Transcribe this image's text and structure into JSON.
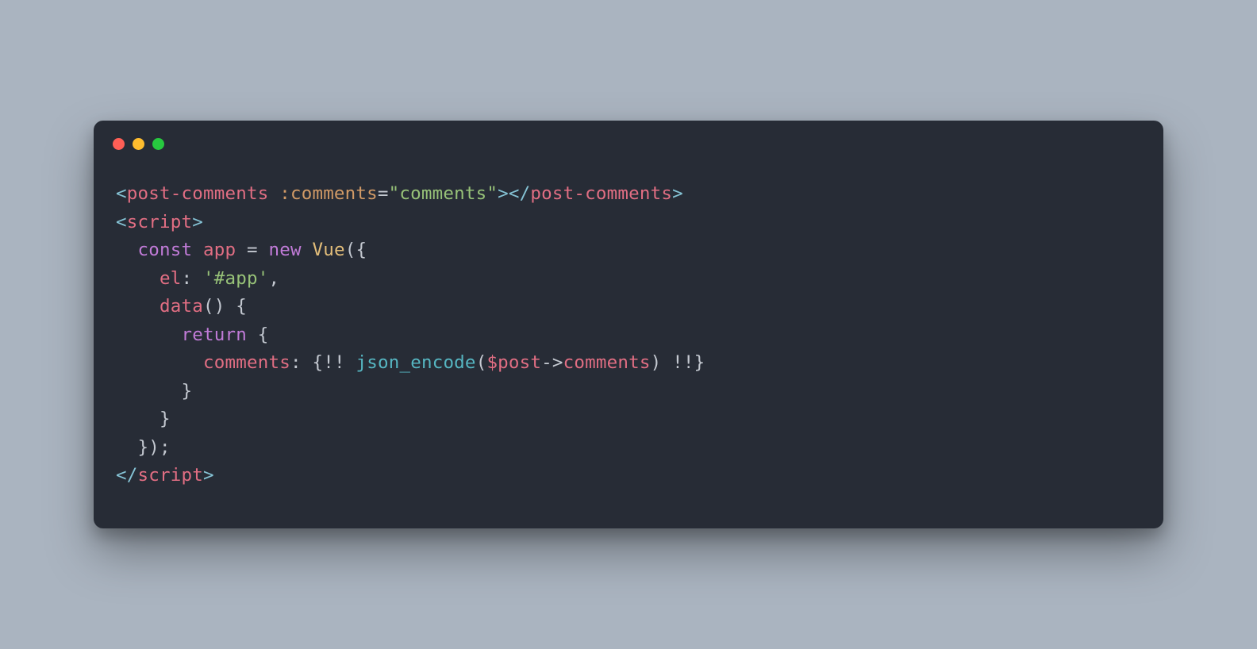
{
  "colors": {
    "background": "#aab4c0",
    "window": "#272c36",
    "traffic_red": "#ff5f56",
    "traffic_yellow": "#ffbd2e",
    "traffic_green": "#27c93f"
  },
  "code": {
    "lines": [
      {
        "indent": 0,
        "tokens": [
          {
            "t": "<",
            "c": "angle"
          },
          {
            "t": "post-comments",
            "c": "tag"
          },
          {
            "t": " ",
            "c": "punc"
          },
          {
            "t": ":comments",
            "c": "attr"
          },
          {
            "t": "=",
            "c": "op"
          },
          {
            "t": "\"comments\"",
            "c": "str"
          },
          {
            "t": ">",
            "c": "angle"
          },
          {
            "t": "</",
            "c": "angle"
          },
          {
            "t": "post-comments",
            "c": "tag"
          },
          {
            "t": ">",
            "c": "angle"
          }
        ]
      },
      {
        "indent": 0,
        "tokens": [
          {
            "t": "<",
            "c": "angle"
          },
          {
            "t": "script",
            "c": "tag"
          },
          {
            "t": ">",
            "c": "angle"
          }
        ]
      },
      {
        "indent": 1,
        "tokens": [
          {
            "t": "const",
            "c": "kw"
          },
          {
            "t": " ",
            "c": "punc"
          },
          {
            "t": "app",
            "c": "var"
          },
          {
            "t": " ",
            "c": "punc"
          },
          {
            "t": "=",
            "c": "op"
          },
          {
            "t": " ",
            "c": "punc"
          },
          {
            "t": "new",
            "c": "kw"
          },
          {
            "t": " ",
            "c": "punc"
          },
          {
            "t": "Vue",
            "c": "class"
          },
          {
            "t": "({",
            "c": "punc"
          }
        ]
      },
      {
        "indent": 2,
        "tokens": [
          {
            "t": "el",
            "c": "prop"
          },
          {
            "t": ": ",
            "c": "punc"
          },
          {
            "t": "'#app'",
            "c": "str"
          },
          {
            "t": ",",
            "c": "punc"
          }
        ]
      },
      {
        "indent": 2,
        "tokens": [
          {
            "t": "data",
            "c": "prop"
          },
          {
            "t": "() {",
            "c": "punc"
          }
        ]
      },
      {
        "indent": 3,
        "tokens": [
          {
            "t": "return",
            "c": "kw"
          },
          {
            "t": " {",
            "c": "punc"
          }
        ]
      },
      {
        "indent": 4,
        "tokens": [
          {
            "t": "comments",
            "c": "prop"
          },
          {
            "t": ": {",
            "c": "punc"
          },
          {
            "t": "!!",
            "c": "op"
          },
          {
            "t": " ",
            "c": "punc"
          },
          {
            "t": "json_encode",
            "c": "func"
          },
          {
            "t": "(",
            "c": "punc"
          },
          {
            "t": "$post",
            "c": "php"
          },
          {
            "t": "->",
            "c": "op"
          },
          {
            "t": "comments",
            "c": "prop"
          },
          {
            "t": ") ",
            "c": "punc"
          },
          {
            "t": "!!",
            "c": "op"
          },
          {
            "t": "}",
            "c": "punc"
          }
        ]
      },
      {
        "indent": 3,
        "tokens": [
          {
            "t": "}",
            "c": "punc"
          }
        ]
      },
      {
        "indent": 2,
        "tokens": [
          {
            "t": "}",
            "c": "punc"
          }
        ]
      },
      {
        "indent": 1,
        "tokens": [
          {
            "t": "});",
            "c": "punc"
          }
        ]
      },
      {
        "indent": 0,
        "tokens": [
          {
            "t": "</",
            "c": "angle"
          },
          {
            "t": "script",
            "c": "tag"
          },
          {
            "t": ">",
            "c": "angle"
          }
        ]
      }
    ]
  }
}
